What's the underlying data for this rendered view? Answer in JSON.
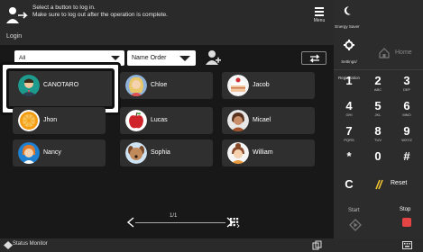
{
  "header": {
    "message_line1": "Select a button to log in.",
    "message_line2": "Make sure to log out after the operation is complete.",
    "login_label": "Login",
    "menu_label": "Menu"
  },
  "filter": {
    "group_value": "All",
    "order_value": "Name Order"
  },
  "users": [
    {
      "name": "CANOTARO",
      "avatar": "man-suit-avatar"
    },
    {
      "name": "Chloe",
      "avatar": "woman-blonde-avatar"
    },
    {
      "name": "Jacob",
      "avatar": "cake-avatar"
    },
    {
      "name": "Jhon",
      "avatar": "orange-fruit-avatar"
    },
    {
      "name": "Lucas",
      "avatar": "apple-avatar"
    },
    {
      "name": "Micael",
      "avatar": "man-dark-avatar"
    },
    {
      "name": "Nancy",
      "avatar": "woman-blue-avatar"
    },
    {
      "name": "Sophia",
      "avatar": "dog-avatar"
    },
    {
      "name": "William",
      "avatar": "woman-bun-avatar"
    }
  ],
  "pager": {
    "page_num": "1/1"
  },
  "keypad": {
    "energy_saver": "Energy Saver",
    "settings_registration": "Settings/ Registration",
    "home": "Home",
    "keys": [
      {
        "big": "1",
        "small": ""
      },
      {
        "big": "2",
        "small": "ABC"
      },
      {
        "big": "3",
        "small": "DEF"
      },
      {
        "big": "4",
        "small": "GHI"
      },
      {
        "big": "5",
        "small": "JKL"
      },
      {
        "big": "6",
        "small": "MNO"
      },
      {
        "big": "7",
        "small": "PQRS"
      },
      {
        "big": "8",
        "small": "TUV"
      },
      {
        "big": "9",
        "small": "WXYZ"
      },
      {
        "big": "*",
        "small": ""
      },
      {
        "big": "0",
        "small": ""
      },
      {
        "big": "#",
        "small": ""
      }
    ],
    "clear": "C",
    "reset": "Reset",
    "start": "Start",
    "stop": "Stop"
  },
  "bottom": {
    "status_monitor": "Status Monitor"
  },
  "colors": {
    "stop_red": "#e54444",
    "background": "#181818",
    "panel": "#2c2c2c"
  }
}
